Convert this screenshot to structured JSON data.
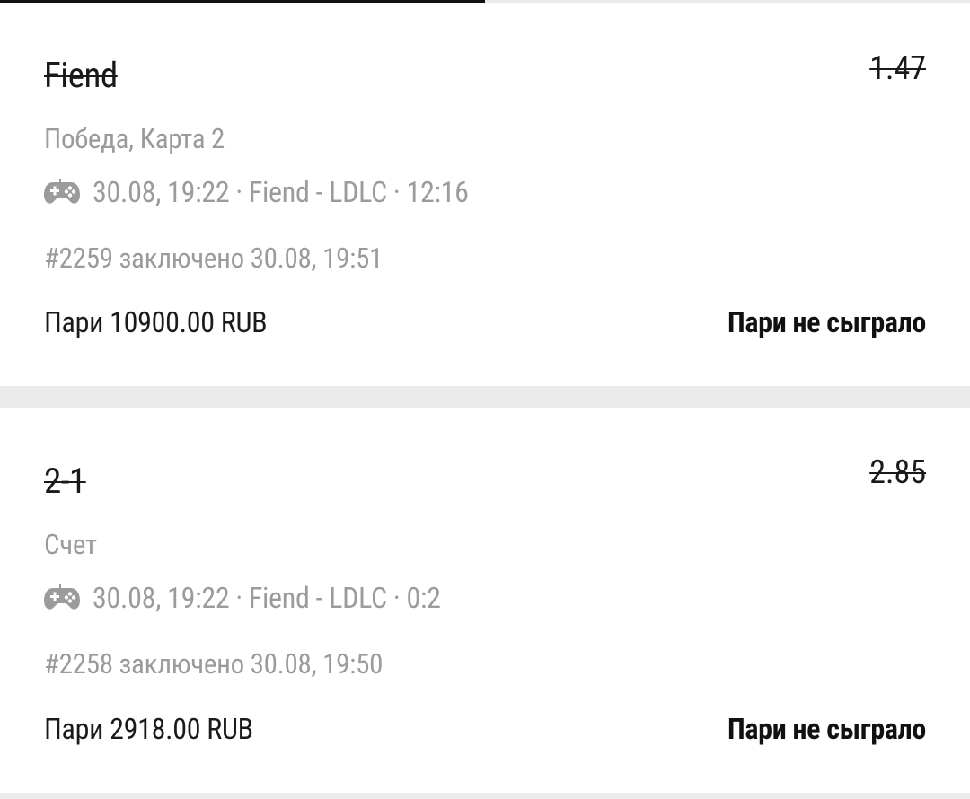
{
  "bets": [
    {
      "selection": "Fiend",
      "odds": "1.47",
      "market": "Победа,  Карта 2",
      "event_icon": "gamepad-icon",
      "event_info": "30.08, 19:22 · Fiend - LDLC · 12:16",
      "bet_id_line": "#2259 заключено 30.08, 19:51",
      "stake": "Пари 10900.00 RUB",
      "status": "Пари не сыграло"
    },
    {
      "selection": "2-1",
      "odds": "2.85",
      "market": "Счет",
      "event_icon": "gamepad-icon",
      "event_info": "30.08, 19:22 · Fiend - LDLC · 0:2",
      "bet_id_line": "#2258 заключено 30.08, 19:50",
      "stake": "Пари 2918.00 RUB",
      "status": "Пари не сыграло"
    }
  ],
  "colors": {
    "background": "#ebebeb",
    "card": "#ffffff",
    "primary_text": "#1a1a1a",
    "secondary_text": "#9b9b9b"
  }
}
